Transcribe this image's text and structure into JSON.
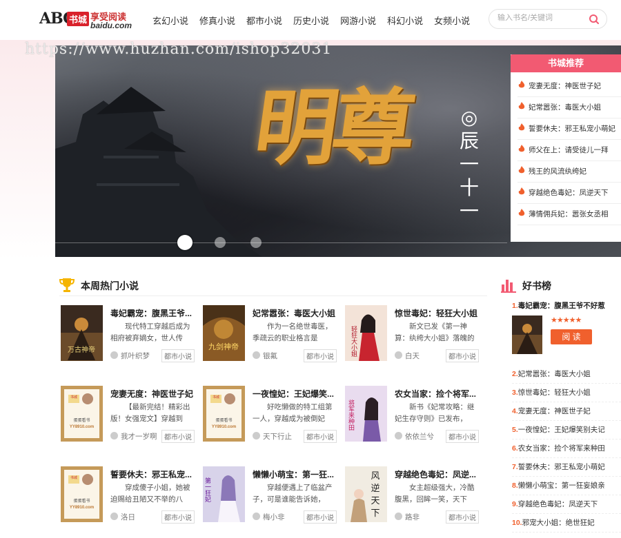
{
  "header": {
    "logo_abc": "ABC",
    "logo_red": "书城",
    "logo_top": "享受阅读",
    "logo_sub": "baidu.com",
    "nav": [
      "玄幻小说",
      "修真小说",
      "都市小说",
      "历史小说",
      "网游小说",
      "科幻小说",
      "女频小说"
    ],
    "search_placeholder": "输入书名/关键词"
  },
  "watermark": "https://www.huzhan.com/ishop32031",
  "banner": {
    "title": "明尊",
    "author": "◎辰一十一"
  },
  "recommend": {
    "title": "书城推荐",
    "items": [
      "宠妻无度：神医世子妃",
      "妃常嚣张：毒医大小姐",
      "誓要休夫：邪王私宠小萌妃",
      "师父在上：请受徒儿一拜",
      "残王的风流纨绔妃",
      "穿越绝色毒妃：凤逆天下",
      "薄情佣兵妃：嚣张女丞相"
    ]
  },
  "hot": {
    "title": "本周热门小说",
    "books": [
      {
        "title": "毒妃霸宠：腹黑王爷...",
        "desc": "现代特工穿越后成为相府被弃嫡女，世人传她...",
        "author": "抓叶织梦",
        "tag": "都市小说"
      },
      {
        "title": "妃常嚣张：毒医大小姐",
        "desc": "作为一名绝世毒医，季疏云的职业格言是——...",
        "author": "银氟",
        "tag": "都市小说"
      },
      {
        "title": "惊世毒妃：轻狂大小姐",
        "desc": "新文已发《第一神算：纨绔大小姐》落魄的变...",
        "author": "白天",
        "tag": "都市小说"
      },
      {
        "title": "宠妻无度：神医世子妃",
        "desc": "【最新完结！精彩出版！女强宠文】穿越到",
        "author": "我才一岁啊",
        "tag": "都市小说"
      },
      {
        "title": "一夜惶妃：王妃爆笑...",
        "desc": "好吃懒做的特工组第一人，穿越成为被倒妃陷...",
        "author": "天下行止",
        "tag": "都市小说"
      },
      {
        "title": "农女当家：捡个将军...",
        "desc": "新书《妃常攻略：继妃生存守则》已发布，求...",
        "author": "依依兰兮",
        "tag": "都市小说"
      },
      {
        "title": "誓要休夫：邪王私宠...",
        "desc": "穿成傻子小姐，她被迫赐给丑陋又不举的八王...",
        "author": "洛日",
        "tag": "都市小说"
      },
      {
        "title": "懒懒小萌宝：第一狂...",
        "desc": "穿越便遇上了临盆产子，可是谁能告诉她，",
        "author": "梅小非",
        "tag": "都市小说"
      },
      {
        "title": "穿越绝色毒妃：凤逆...",
        "desc": "女主超级强大，冷酷腹黑，回眸一笑，天下风...",
        "author": "路非",
        "tag": "都市小说"
      }
    ]
  },
  "ranking": {
    "title": "好书榜",
    "first": {
      "num": "1.",
      "title": "毒妃霸宠：腹黑王爷不好惹",
      "stars": "★★★★★",
      "read": "阅 读"
    },
    "items": [
      {
        "num": "2.",
        "title": "妃常嚣张：毒医大小姐"
      },
      {
        "num": "3.",
        "title": "惊世毒妃：轻狂大小姐"
      },
      {
        "num": "4.",
        "title": "宠妻无度：神医世子妃"
      },
      {
        "num": "5.",
        "title": "一夜惶妃：王妃爆笑别夫记"
      },
      {
        "num": "6.",
        "title": "农女当家：捡个将军来种田"
      },
      {
        "num": "7.",
        "title": "誓要休夫：邪王私宠小萌妃"
      },
      {
        "num": "8.",
        "title": "懒懒小萌宝：第一狂妄娘亲"
      },
      {
        "num": "9.",
        "title": "穿越绝色毒妃：凤逆天下"
      },
      {
        "num": "10.",
        "title": "邪宠大小姐：绝世狂妃"
      }
    ]
  },
  "placeholder_cover": {
    "top": "书城",
    "name": "蛋蛋看书",
    "site": "YY8910.com"
  },
  "colors": {
    "accent": "#f25a72",
    "orange": "#f0602d"
  }
}
